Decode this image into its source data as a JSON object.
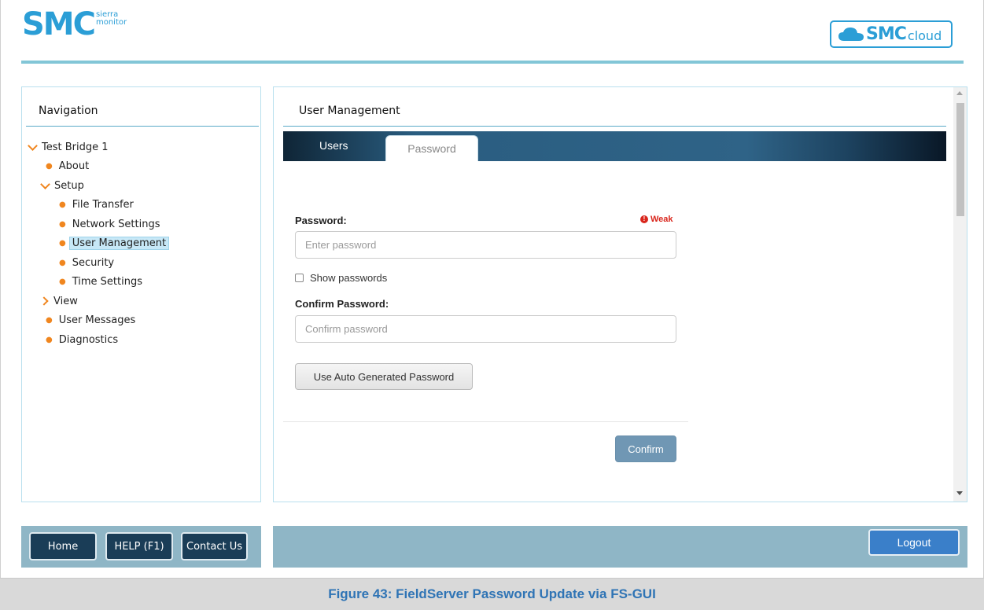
{
  "header": {
    "logo_main": "SMC",
    "logo_sub": "sierra monitor",
    "cloud_logo_main": "SMC",
    "cloud_logo_sub": "cloud"
  },
  "navigation": {
    "title": "Navigation",
    "items": [
      {
        "label": "Test Bridge 1",
        "kind": "expanded"
      },
      {
        "label": "About",
        "kind": "leaf"
      },
      {
        "label": "Setup",
        "kind": "expanded"
      },
      {
        "label": "File Transfer",
        "kind": "leaf"
      },
      {
        "label": "Network Settings",
        "kind": "leaf"
      },
      {
        "label": "User Management",
        "kind": "leaf",
        "selected": true
      },
      {
        "label": "Security",
        "kind": "leaf"
      },
      {
        "label": "Time Settings",
        "kind": "leaf"
      },
      {
        "label": "View",
        "kind": "collapsed"
      },
      {
        "label": "User Messages",
        "kind": "leaf"
      },
      {
        "label": "Diagnostics",
        "kind": "leaf"
      }
    ]
  },
  "footer": {
    "home_label": "Home",
    "help_label": "HELP (F1)",
    "contact_label": "Contact Us",
    "logout_label": "Logout"
  },
  "main": {
    "title": "User Management",
    "tabs": [
      {
        "label": "Users",
        "active": false
      },
      {
        "label": "Password",
        "active": true
      }
    ],
    "form": {
      "password_label": "Password:",
      "strength_text": "Weak",
      "strength_color": "#d9261c",
      "password_placeholder": "Enter password",
      "password_value": "",
      "show_passwords_label": "Show passwords",
      "show_passwords_checked": false,
      "confirm_label": "Confirm Password:",
      "confirm_placeholder": "Confirm password",
      "confirm_value": "",
      "auto_generate_label": "Use Auto Generated Password",
      "confirm_button_label": "Confirm"
    }
  },
  "caption": "Figure 43: FieldServer Password Update via FS-GUI",
  "colors": {
    "brand_blue": "#2b9ed6",
    "accent_orange": "#f0861f",
    "footer_bar": "#8fb6c6",
    "nav_button": "#1a3d57",
    "logout_button": "#3a7fc9",
    "caption_text": "#2f74b5"
  }
}
